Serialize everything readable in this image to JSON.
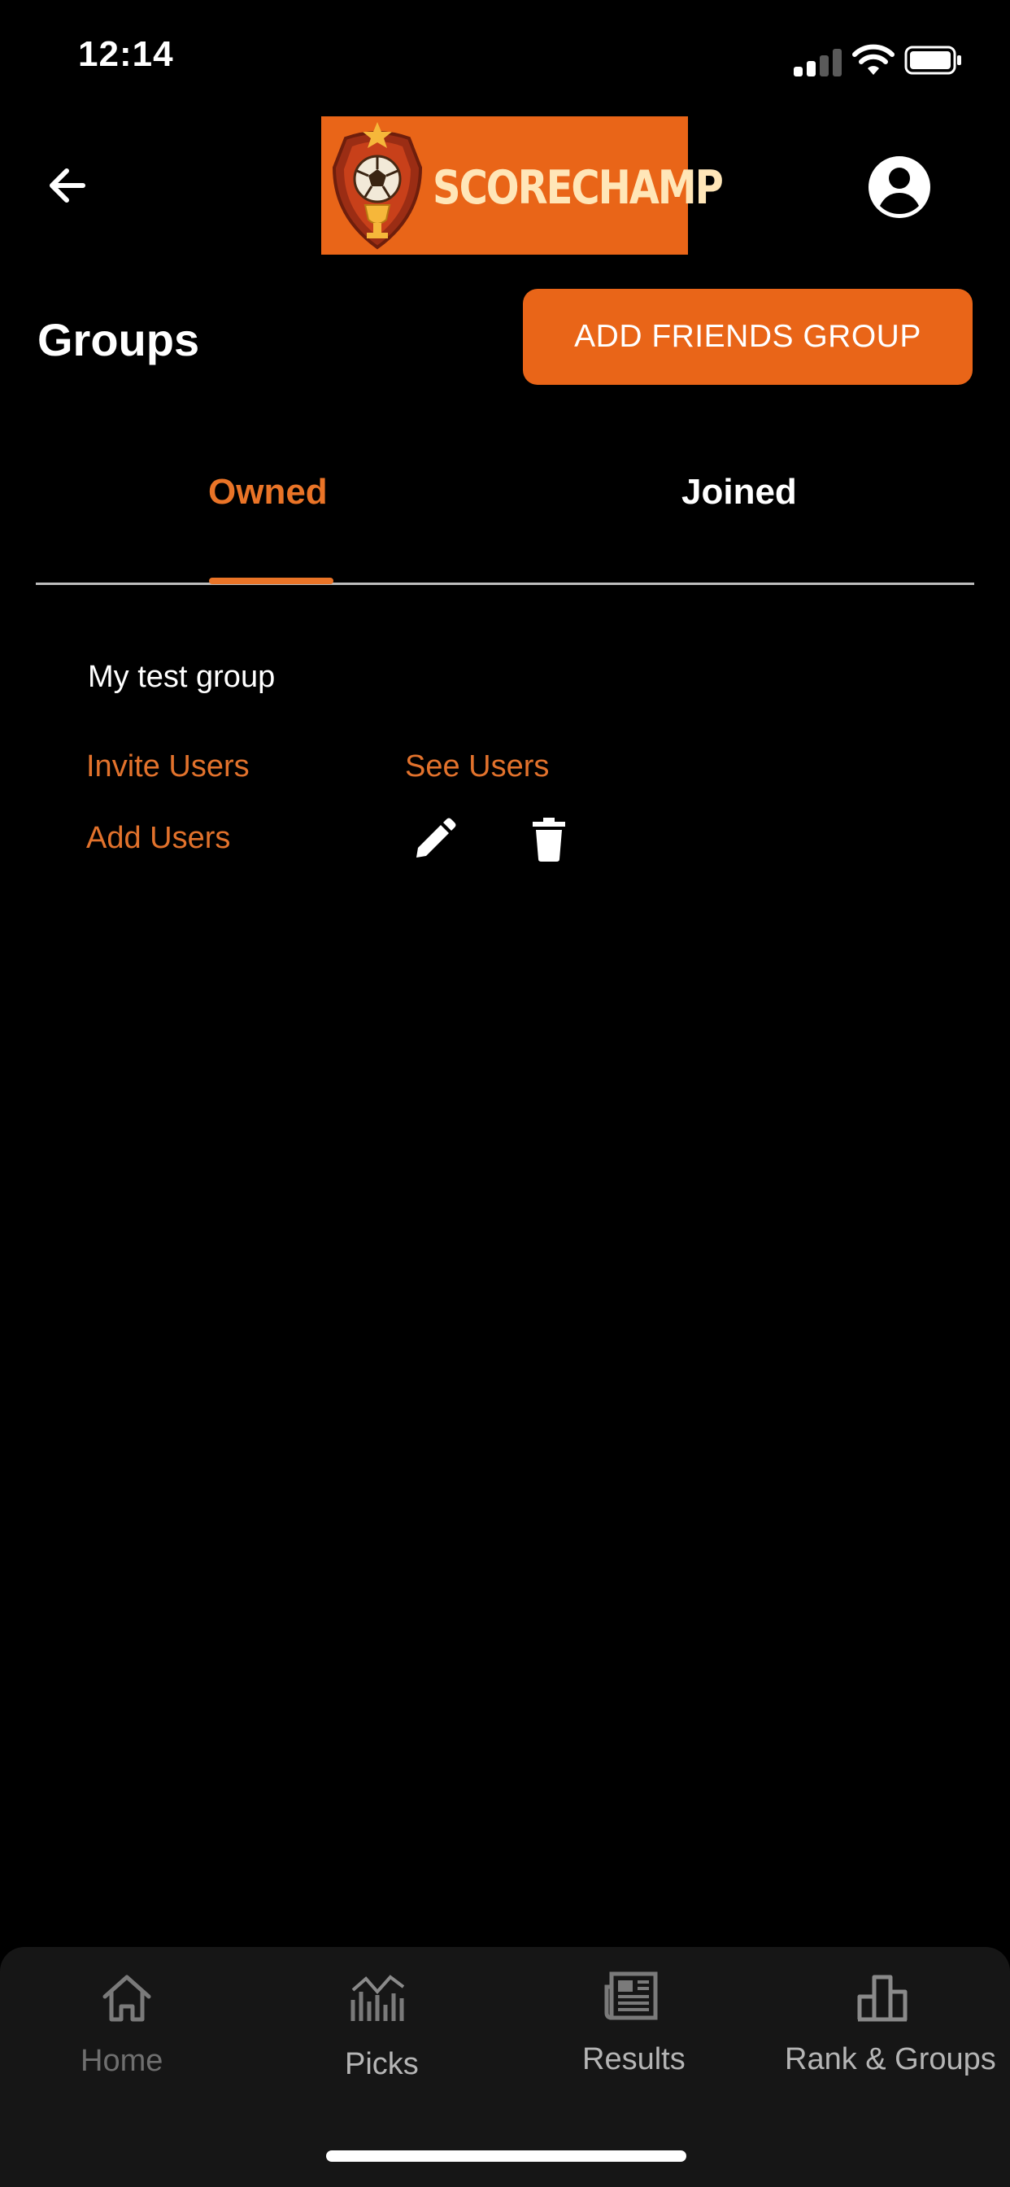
{
  "status_bar": {
    "time": "12:14"
  },
  "header": {
    "logo_text": "SCORECHAMP"
  },
  "page": {
    "title": "Groups",
    "add_group_label": "ADD FRIENDS GROUP"
  },
  "tabs": [
    {
      "label": "Owned",
      "active": true
    },
    {
      "label": "Joined",
      "active": false
    }
  ],
  "group": {
    "name": "My test group",
    "invite_label": "Invite Users",
    "see_label": "See Users",
    "add_label": "Add Users"
  },
  "bottom_nav": [
    {
      "label": "Home",
      "icon": "home-icon"
    },
    {
      "label": "Picks",
      "icon": "chart-icon"
    },
    {
      "label": "Results",
      "icon": "newspaper-icon"
    },
    {
      "label": "Rank & Groups",
      "icon": "bar-chart-icon"
    }
  ],
  "colors": {
    "accent": "#e96518",
    "background": "#000000",
    "nav_background": "#161616"
  }
}
